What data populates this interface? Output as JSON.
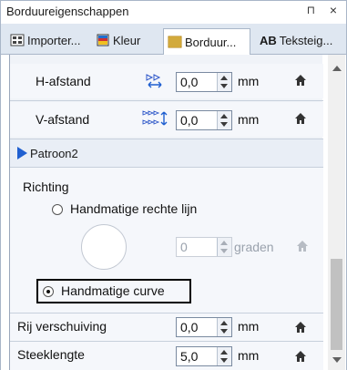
{
  "window": {
    "title": "Borduureigenschappen",
    "pin_glyph": "⊓",
    "close_glyph": "×"
  },
  "tabs": [
    {
      "label": "Importer...",
      "icon": "import-icon"
    },
    {
      "label": "Kleur",
      "icon": "color-icon"
    },
    {
      "label": "Borduur...",
      "icon": "embroidery-icon"
    },
    {
      "label": "Teksteig...",
      "icon_text": "AB"
    }
  ],
  "fields": {
    "h_afstand": {
      "label": "H-afstand",
      "value": "0,0",
      "unit": "mm"
    },
    "v_afstand": {
      "label": "V-afstand",
      "value": "0,0",
      "unit": "mm"
    },
    "pattern_link": "Patroon2",
    "richting": "Richting",
    "radio_straight": "Handmatige rechte lijn",
    "angle": {
      "value": "0",
      "unit": "graden"
    },
    "radio_curve": "Handmatige curve",
    "rij_verschuiving": {
      "label": "Rij verschuiving",
      "value": "0,0",
      "unit": "mm"
    },
    "steeklengte": {
      "label": "Steeklengte",
      "value": "5,0",
      "unit": "mm"
    }
  },
  "colors": {
    "accent": "#1f5fd0",
    "highlight_border": "#000000"
  }
}
